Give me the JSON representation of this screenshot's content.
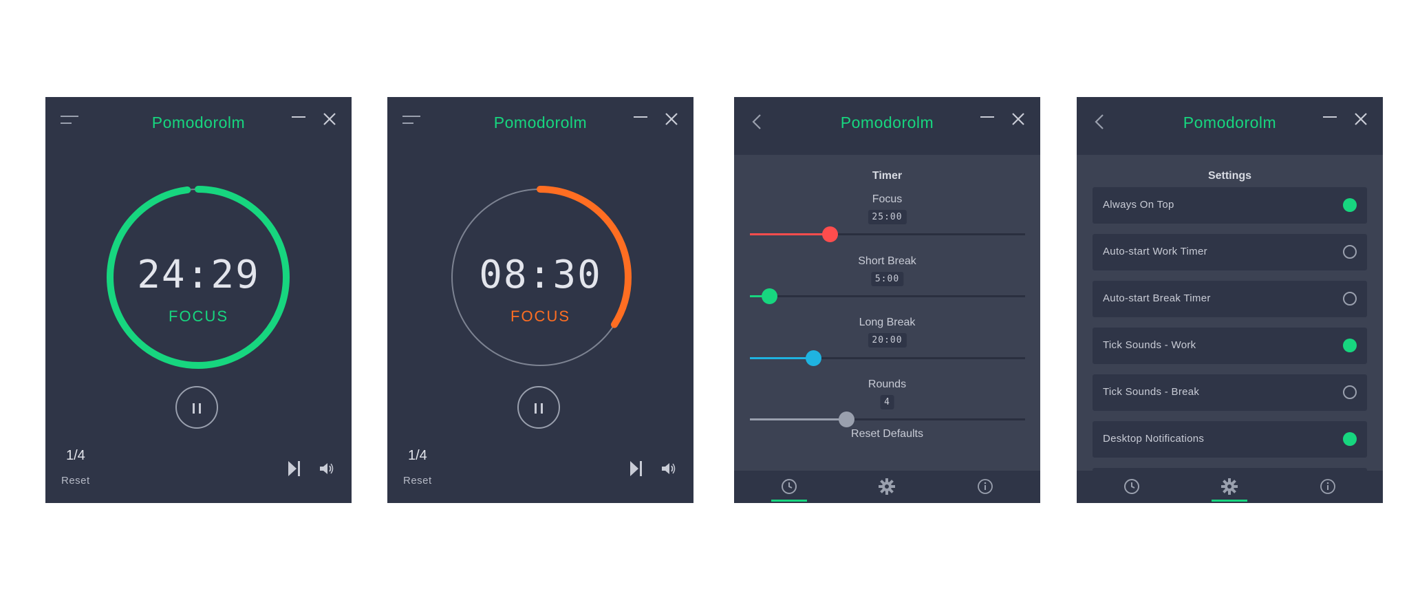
{
  "colors": {
    "accent": "#17d67f",
    "focus_break": "#ff6e22",
    "panel_bg": "#2f3547",
    "content_bg": "#3c4253",
    "slider_focus": "#ff4d4d",
    "slider_short": "#17d67f",
    "slider_long": "#1fb3e0",
    "slider_rounds": "#9aa0ae"
  },
  "app": {
    "title": "Pomodorolm"
  },
  "timer_views": [
    {
      "time": "24:29",
      "mode": "FOCUS",
      "mode_color": "#17d67f",
      "remaining_fraction": 0.98,
      "round": "1/4",
      "reset_label": "Reset"
    },
    {
      "time": "08:30",
      "mode": "FOCUS",
      "mode_color": "#ff6e22",
      "remaining_fraction": 0.34,
      "round": "1/4",
      "reset_label": "Reset"
    }
  ],
  "timer_settings": {
    "title": "Timer",
    "items": [
      {
        "label": "Focus",
        "value": "25:00",
        "fraction": 0.29
      },
      {
        "label": "Short Break",
        "value": "5:00",
        "fraction": 0.07
      },
      {
        "label": "Long Break",
        "value": "20:00",
        "fraction": 0.23
      },
      {
        "label": "Rounds",
        "value": "4",
        "fraction": 0.35
      }
    ],
    "reset_defaults": "Reset Defaults"
  },
  "settings": {
    "title": "Settings",
    "toggles": [
      {
        "label": "Always On Top",
        "checked": true
      },
      {
        "label": "Auto-start Work Timer",
        "checked": false
      },
      {
        "label": "Auto-start Break Timer",
        "checked": false
      },
      {
        "label": "Tick Sounds - Work",
        "checked": true
      },
      {
        "label": "Tick Sounds - Break",
        "checked": false
      },
      {
        "label": "Desktop Notifications",
        "checked": true
      }
    ]
  },
  "nav_icons": [
    "clock-icon",
    "gear-icon",
    "info-icon"
  ]
}
